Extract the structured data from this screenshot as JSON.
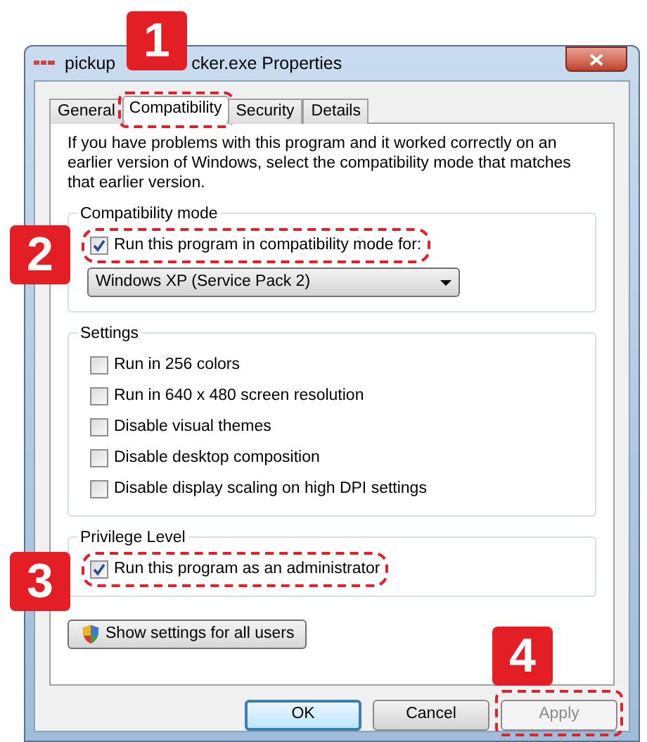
{
  "window": {
    "title_parts": [
      "pickup",
      "cker.exe Properties"
    ]
  },
  "tabs": [
    {
      "label": "General",
      "selected": false,
      "highlighted": false
    },
    {
      "label": "Compatibility",
      "selected": true,
      "highlighted": true
    },
    {
      "label": "Security",
      "selected": false,
      "highlighted": false
    },
    {
      "label": "Details",
      "selected": false,
      "highlighted": false
    }
  ],
  "intro": "If you have problems with this program and it worked correctly on an earlier version of Windows, select the compatibility mode that matches that earlier version.",
  "groups": [
    {
      "title": "Compatibility mode",
      "items": [
        {
          "kind": "checkbox",
          "label": "Run this program in compatibility mode for:",
          "checked": true,
          "highlighted": true
        },
        {
          "kind": "dropdown",
          "value": "Windows XP (Service Pack 2)"
        }
      ]
    },
    {
      "title": "Settings",
      "items": [
        {
          "kind": "checkbox",
          "label": "Run in 256 colors",
          "checked": false,
          "highlighted": false
        },
        {
          "kind": "checkbox",
          "label": "Run in 640 x 480 screen resolution",
          "checked": false,
          "highlighted": false
        },
        {
          "kind": "checkbox",
          "label": "Disable visual themes",
          "checked": false,
          "highlighted": false
        },
        {
          "kind": "checkbox",
          "label": "Disable desktop composition",
          "checked": false,
          "highlighted": false
        },
        {
          "kind": "checkbox",
          "label": "Disable display scaling on high DPI settings",
          "checked": false,
          "highlighted": false
        }
      ]
    },
    {
      "title": "Privilege Level",
      "items": [
        {
          "kind": "checkbox",
          "label": "Run this program as an administrator",
          "checked": true,
          "highlighted": true
        }
      ]
    }
  ],
  "show_all_button": "Show settings for all users",
  "buttons": [
    {
      "label": "OK",
      "default": true,
      "disabled": false,
      "highlighted": false
    },
    {
      "label": "Cancel",
      "default": false,
      "disabled": false,
      "highlighted": false
    },
    {
      "label": "Apply",
      "default": false,
      "disabled": true,
      "highlighted": true
    }
  ],
  "callouts": [
    "1",
    "2",
    "3",
    "4"
  ]
}
